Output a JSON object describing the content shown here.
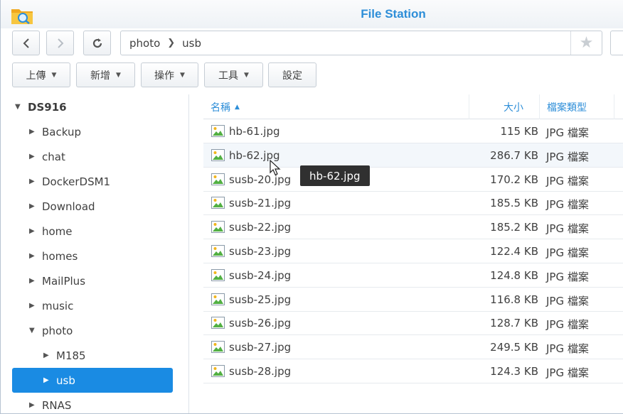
{
  "window": {
    "title": "File Station"
  },
  "toolbar": {
    "back_icon": "chevron-left-icon",
    "forward_icon": "chevron-right-icon",
    "refresh_icon": "refresh-icon",
    "path": [
      "photo",
      "usb"
    ],
    "favorite_icon": "star-icon",
    "buttons": [
      {
        "label": "上傳",
        "dropdown": true
      },
      {
        "label": "新增",
        "dropdown": true
      },
      {
        "label": "操作",
        "dropdown": true
      },
      {
        "label": "工具",
        "dropdown": true
      },
      {
        "label": "設定",
        "dropdown": false
      }
    ]
  },
  "sidebar": {
    "root": "DS916",
    "items": [
      {
        "label": "Backup"
      },
      {
        "label": "chat"
      },
      {
        "label": "DockerDSM1"
      },
      {
        "label": "Download"
      },
      {
        "label": "home"
      },
      {
        "label": "homes"
      },
      {
        "label": "MailPlus"
      },
      {
        "label": "music"
      },
      {
        "label": "photo",
        "expanded": true
      },
      {
        "label": "M185",
        "child": true
      },
      {
        "label": "usb",
        "child": true,
        "selected": true
      },
      {
        "label": "RNAS"
      }
    ]
  },
  "filelist": {
    "columns": {
      "name": "名稱",
      "size": "大小",
      "type": "檔案類型"
    },
    "sort": {
      "column": "name",
      "direction": "ascending"
    },
    "rows": [
      {
        "name": "hb-61.jpg",
        "size": "115 KB",
        "type": "JPG 檔案"
      },
      {
        "name": "hb-62.jpg",
        "size": "286.7 KB",
        "type": "JPG 檔案"
      },
      {
        "name": "susb-20.jpg",
        "size": "170.2 KB",
        "type": "JPG 檔案"
      },
      {
        "name": "susb-21.jpg",
        "size": "185.5 KB",
        "type": "JPG 檔案"
      },
      {
        "name": "susb-22.jpg",
        "size": "185.2 KB",
        "type": "JPG 檔案"
      },
      {
        "name": "susb-23.jpg",
        "size": "122.4 KB",
        "type": "JPG 檔案"
      },
      {
        "name": "susb-24.jpg",
        "size": "124.8 KB",
        "type": "JPG 檔案"
      },
      {
        "name": "susb-25.jpg",
        "size": "116.8 KB",
        "type": "JPG 檔案"
      },
      {
        "name": "susb-26.jpg",
        "size": "128.7 KB",
        "type": "JPG 檔案"
      },
      {
        "name": "susb-27.jpg",
        "size": "249.5 KB",
        "type": "JPG 檔案"
      },
      {
        "name": "susb-28.jpg",
        "size": "124.3 KB",
        "type": "JPG 檔案"
      }
    ]
  },
  "tooltip": {
    "text": "hb-62.jpg"
  },
  "colors": {
    "accent": "#1a8be3",
    "title": "#2d8ed8",
    "tooltip_bg": "#303030"
  }
}
